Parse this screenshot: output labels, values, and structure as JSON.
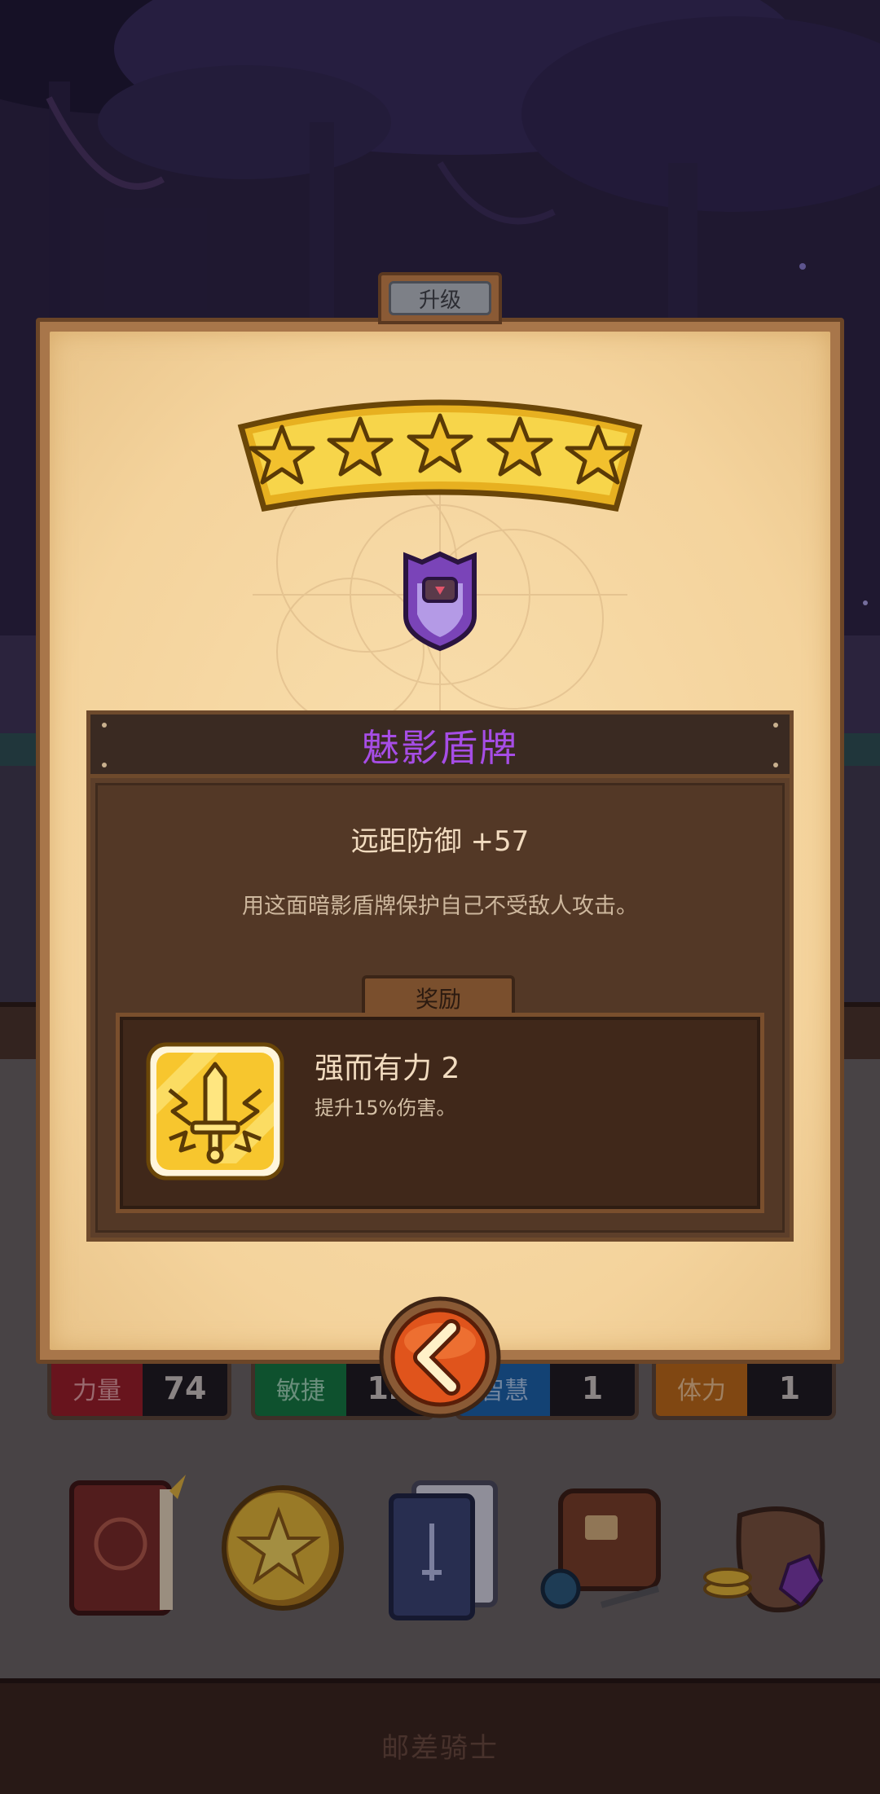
{
  "dialog": {
    "tab_label": "升级",
    "stars_filled": 5,
    "stars_total": 5,
    "item_name": "魅影盾牌",
    "item_name_color": "#a64de6",
    "stat_text": "远距防御 +57",
    "description": "用这面暗影盾牌保护自己不受敌人攻击。",
    "reward_tab_label": "奖励",
    "reward": {
      "title": "强而有力 2",
      "description": "提升15%伤害。",
      "icon": "sword-burst-icon"
    },
    "back_button_icon": "chevron-left-icon"
  },
  "stats": [
    {
      "label": "力量",
      "value": "74",
      "color": "#9c1c22"
    },
    {
      "label": "敏捷",
      "value": "12",
      "color": "#127a3c"
    },
    {
      "label": "智慧",
      "value": "1",
      "color": "#1a63a8"
    },
    {
      "label": "体力",
      "value": "1",
      "color": "#c06a12"
    }
  ],
  "inventory": [
    {
      "icon": "character-book-icon"
    },
    {
      "icon": "gold-star-coin-icon"
    },
    {
      "icon": "card-deck-icon"
    },
    {
      "icon": "backpack-icon"
    },
    {
      "icon": "treasure-bag-icon"
    }
  ],
  "bottom_title": "邮差骑士"
}
